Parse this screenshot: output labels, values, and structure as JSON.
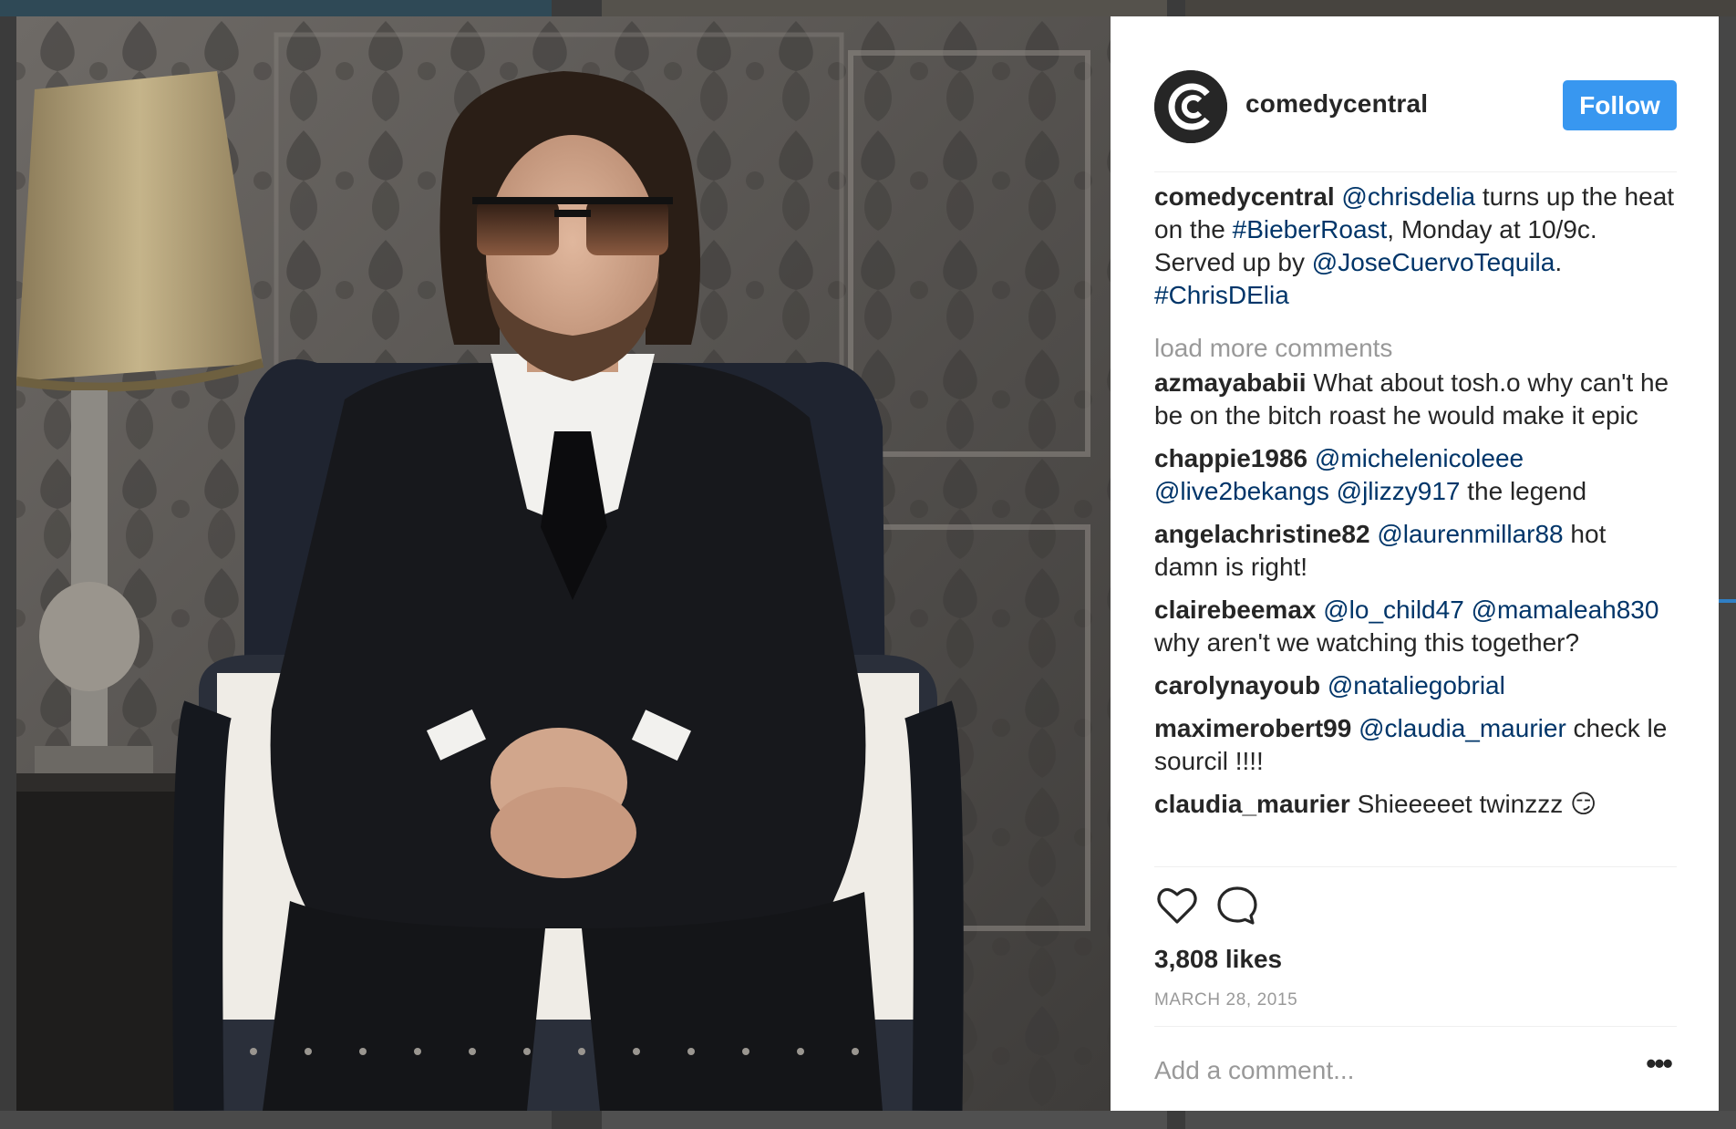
{
  "post": {
    "username": "comedycentral",
    "follow_label": "Follow",
    "likes": "3,808 likes",
    "date": "MARCH 28, 2015",
    "comment_placeholder": "Add a comment...",
    "more_glyph": "•••"
  },
  "caption": {
    "username": "comedycentral",
    "parts": [
      {
        "text": "@chrisdelia",
        "mention": true
      },
      {
        "text": " turns up the heat on the ",
        "mention": false
      },
      {
        "text": "#BieberRoast",
        "mention": true
      },
      {
        "text": ", Monday at 10/9c. Served up by ",
        "mention": false
      },
      {
        "text": "@JoseCuervoTequila",
        "mention": true
      },
      {
        "text": ". ",
        "mention": false
      },
      {
        "text": "#ChrisDElia",
        "mention": true
      }
    ]
  },
  "load_more": "load more comments",
  "comments": [
    {
      "username": "azmayababii",
      "parts": [
        {
          "text": "What about tosh.o why can't he be on the bitch roast he would make it epic",
          "mention": false
        }
      ]
    },
    {
      "username": "chappie1986",
      "parts": [
        {
          "text": "@michelenicoleee",
          "mention": true
        },
        {
          "text": " ",
          "mention": false
        },
        {
          "text": "@live2bekangs",
          "mention": true
        },
        {
          "text": " ",
          "mention": false
        },
        {
          "text": "@jlizzy917",
          "mention": true
        },
        {
          "text": " the legend",
          "mention": false
        }
      ]
    },
    {
      "username": "angelachristine82",
      "parts": [
        {
          "text": "@laurenmillar88",
          "mention": true
        },
        {
          "text": " hot damn is right!",
          "mention": false
        }
      ]
    },
    {
      "username": "clairebeemax",
      "parts": [
        {
          "text": "@lo_child47",
          "mention": true
        },
        {
          "text": " ",
          "mention": false
        },
        {
          "text": "@mamaleah830",
          "mention": true
        },
        {
          "text": " why aren't we watching this together?",
          "mention": false
        }
      ]
    },
    {
      "username": "carolynayoub",
      "parts": [
        {
          "text": "@nataliegobrial",
          "mention": true
        }
      ]
    },
    {
      "username": "maximerobert99",
      "parts": [
        {
          "text": "@claudia_maurier",
          "mention": true
        },
        {
          "text": " check le sourcil !!!!",
          "mention": false
        }
      ]
    },
    {
      "username": "claudia_maurier",
      "parts": [
        {
          "text": "Shieeeeet twinzzz 😏",
          "mention": false
        }
      ]
    }
  ],
  "icons": {
    "avatar": "comedy-central-logo",
    "like": "heart-outline-icon",
    "comment": "speech-bubble-icon",
    "more": "ellipsis-icon"
  },
  "colors": {
    "follow_button": "#3897f0",
    "mention": "#003569",
    "muted": "#999999",
    "text": "#262626"
  }
}
